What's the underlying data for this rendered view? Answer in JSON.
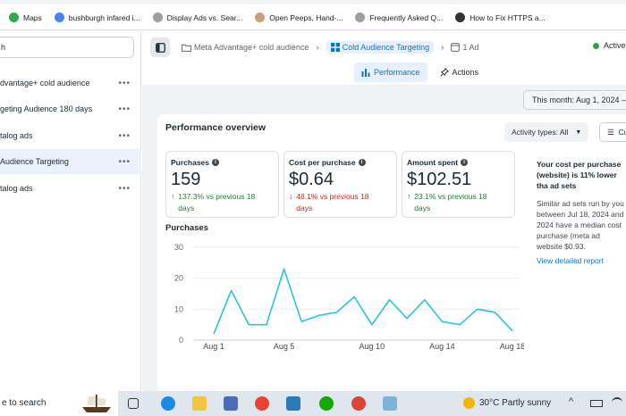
{
  "bookmarks": [
    {
      "label": "Maps",
      "color": "#34a853"
    },
    {
      "label": "bushburgh infared i...",
      "color": "#4285f4"
    },
    {
      "label": "Display Ads vs. Sear...",
      "color": "#9e9e9e"
    },
    {
      "label": "Open Peeps, Hand-...",
      "color": "#c8a27a"
    },
    {
      "label": "Frequently Asked Q...",
      "color": "#9e9e9e"
    },
    {
      "label": "How to Fix HTTPS a...",
      "color": "#333333"
    }
  ],
  "left": {
    "search_value": "h",
    "items": [
      {
        "label": "dvantage+ cold audience"
      },
      {
        "label": "geting Audience 180 days"
      },
      {
        "label": "talog ads"
      },
      {
        "label": "Audience Targeting"
      },
      {
        "label": "talog ads"
      }
    ],
    "more_glyph": "•••"
  },
  "breadcrumb": {
    "campaign": "Meta Advantage+ cold audience",
    "adset": "Cold Audience Targeting",
    "ad": "1 Ad"
  },
  "status": "Active",
  "tabs": {
    "performance": "Performance",
    "actions": "Actions"
  },
  "date_range": "This month: Aug 1, 2024 –",
  "overview": {
    "title": "Performance overview",
    "activity_btn": "Activity types: All",
    "c_btn": "Cu",
    "metrics": [
      {
        "label": "Purchases",
        "value": "159",
        "arrow": "↑",
        "change": "137.3% vs previous 18",
        "change2": "days",
        "trend": "up"
      },
      {
        "label": "Cost per purchase",
        "value": "$0.64",
        "arrow": "↓",
        "change": "48.1% vs previous 18",
        "change2": "days",
        "trend": "down"
      },
      {
        "label": "Amount spent",
        "value": "$102.51",
        "arrow": "↑",
        "change": "23.1% vs previous 18",
        "change2": "days",
        "trend": "up"
      }
    ],
    "purchases_label": "Purchases"
  },
  "insight": {
    "title": "Your cost per purchase (website) is 11% lower tha ad sets",
    "body": "Similar ad sets run by you between Jul 18, 2024 and 2024 have a median cost purchase (meta ad website $0.93.",
    "link": "View detailed report"
  },
  "chart_data": {
    "type": "line",
    "title": "Purchases",
    "x": [
      1,
      2,
      3,
      4,
      5,
      6,
      7,
      8,
      9,
      10,
      11,
      12,
      13,
      14,
      15,
      16,
      17,
      18
    ],
    "values": [
      2,
      16,
      5,
      5,
      23,
      6,
      8,
      9,
      14,
      5,
      13,
      7,
      13,
      6,
      5,
      10,
      9,
      3
    ],
    "tick_positions": [
      1,
      5,
      10,
      14,
      18
    ],
    "tick_labels": [
      "Aug 1",
      "Aug 5",
      "Aug 10",
      "Aug 14",
      "Aug 18"
    ],
    "ylim": [
      0,
      30
    ],
    "yticks": [
      0,
      10,
      20,
      30
    ],
    "color": "#2cc4d4",
    "grid": true
  },
  "taskbar": {
    "search": "e to search",
    "weather": "30°C  Partly sunny"
  }
}
